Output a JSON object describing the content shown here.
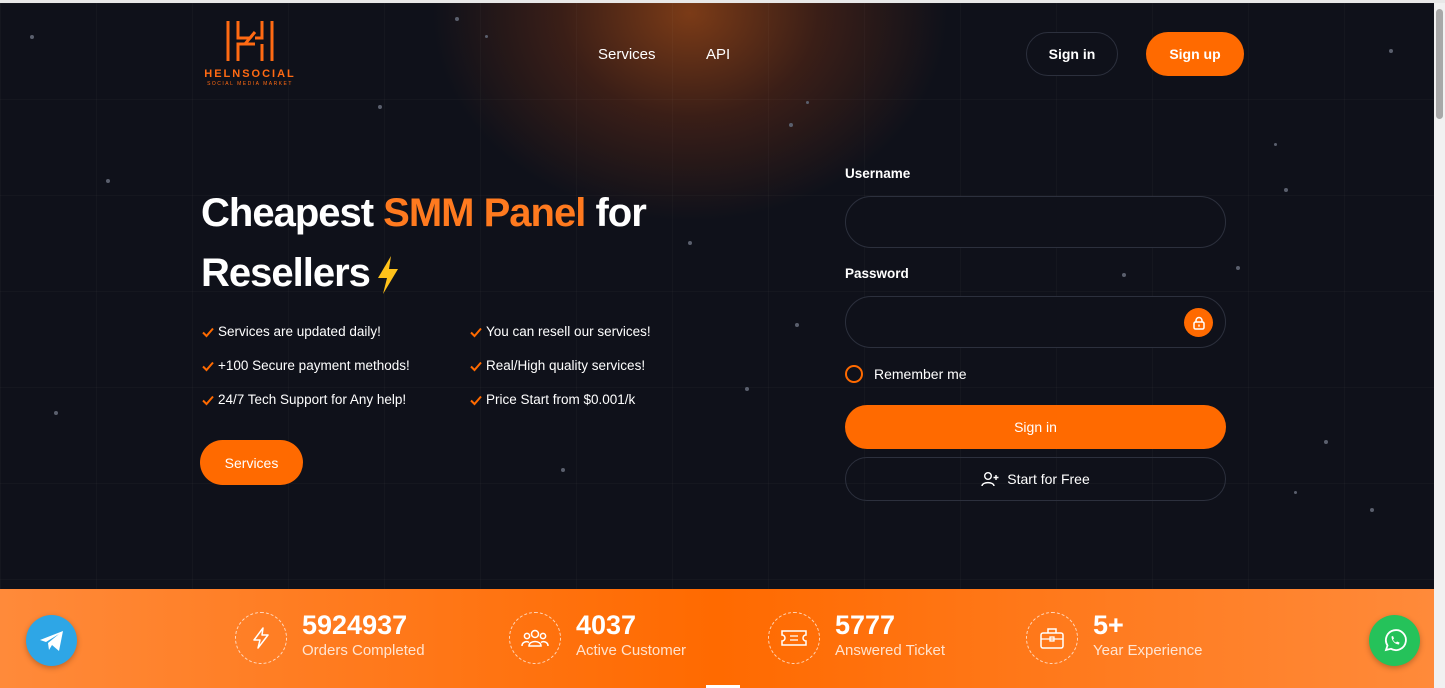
{
  "brand": {
    "name": "HELNSOCIAL",
    "tagline": "SOCIAL MEDIA MARKET",
    "accent_color": "#ff6a00"
  },
  "nav": {
    "services": "Services",
    "api": "API",
    "signin": "Sign in",
    "signup": "Sign up"
  },
  "hero": {
    "title_part1": "Cheapest ",
    "title_accent": "SMM Panel",
    "title_part2": " for",
    "title_line2": "Resellers",
    "features": [
      "Services are updated daily!",
      "You can resell our services!",
      "+100 Secure payment methods!",
      "Real/High quality services!",
      "24/7 Tech Support for Any help!",
      "Price Start from $0.001/k"
    ],
    "services_button": "Services"
  },
  "login": {
    "username_label": "Username",
    "username_value": "",
    "password_label": "Password",
    "password_value": "",
    "remember_label": "Remember me",
    "signin_button": "Sign in",
    "free_button": "Start for Free"
  },
  "stats": [
    {
      "value": "5924937",
      "label": "Orders Completed",
      "icon": "lightning-icon"
    },
    {
      "value": "4037",
      "label": "Active Customer",
      "icon": "users-icon"
    },
    {
      "value": "5777",
      "label": "Answered Ticket",
      "icon": "ticket-icon"
    },
    {
      "value": "5+",
      "label": "Year Experience",
      "icon": "briefcase-icon"
    }
  ],
  "social": {
    "telegram_icon": "telegram-icon",
    "whatsapp_icon": "whatsapp-icon"
  }
}
